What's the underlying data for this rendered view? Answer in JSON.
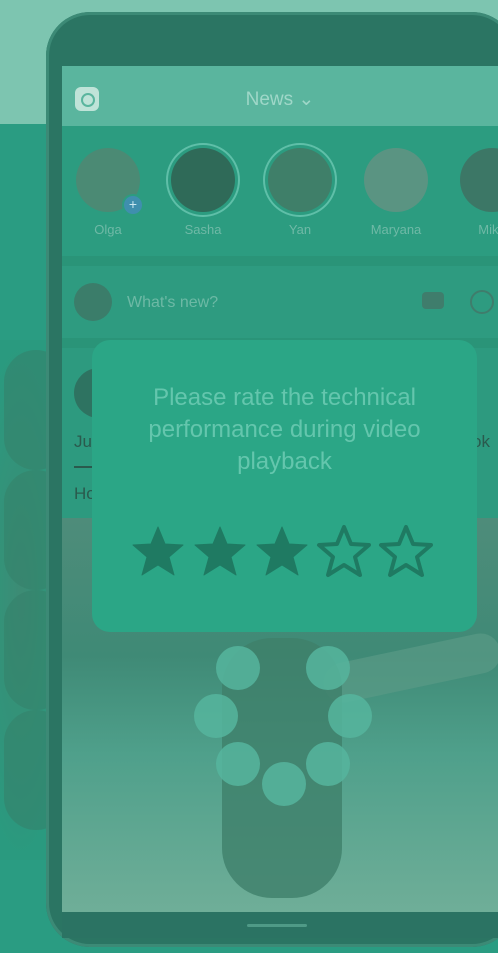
{
  "app_bar": {
    "title": "News ⌄",
    "camera_icon": "camera-icon"
  },
  "stories": [
    {
      "name": "Olga",
      "has_add_badge": true,
      "add_badge": "+",
      "color": "#4b8a74"
    },
    {
      "name": "Sasha",
      "has_add_badge": false,
      "color": "#2f6a58"
    },
    {
      "name": "Yan",
      "has_add_badge": false,
      "color": "#3f7f69"
    },
    {
      "name": "Maryana",
      "has_add_badge": false,
      "color": "#5a9482"
    },
    {
      "name": "Mikh",
      "has_add_badge": false,
      "color": "#3c7766"
    }
  ],
  "composer": {
    "placeholder": "What's new?",
    "icons": [
      "camera-icon",
      "target-icon"
    ]
  },
  "post": {
    "text_line1": "Ju",
    "text_line2": "Ho",
    "text_right": "ok"
  },
  "rating_dialog": {
    "prompt": "Please rate the technical performance during video playback",
    "rating": 3,
    "max_rating": 5,
    "filled_color": "#1f7a62",
    "empty_color": "#2ba686"
  },
  "loading_spinner": {
    "dot_count": 8
  }
}
